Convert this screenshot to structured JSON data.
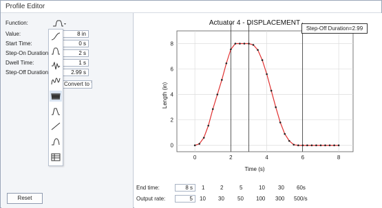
{
  "window": {
    "title": "Profile Editor"
  },
  "left": {
    "function_label": "Function:",
    "fields": [
      {
        "label": "Value:",
        "value": "8 in"
      },
      {
        "label": "Start Time:",
        "value": "0 s"
      },
      {
        "label": "Step-On Duration:",
        "value": "2 s"
      },
      {
        "label": "Dwell Time:",
        "value": "1 s"
      },
      {
        "label": "Step-Off Duration:",
        "value": "2.99 s"
      }
    ],
    "convert_label": "Convert to Table",
    "reset_label": "Reset",
    "menu_icons": [
      "s-curve-icon",
      "pulse-icon",
      "sine-burst-icon",
      "zigzag-icon",
      "wave-ramp-icon",
      "ramp-icon",
      "trapezoid-icon",
      "table-icon"
    ]
  },
  "chart_data": {
    "type": "line",
    "title": "Actuator 4 - DISPLACEMENT",
    "xlabel": "Time (s)",
    "ylabel": "Length (in)",
    "xlim": [
      -1,
      8.8
    ],
    "ylim": [
      -0.5,
      9
    ],
    "xticks": [
      0,
      2,
      4,
      6,
      8
    ],
    "yticks": [
      0,
      2,
      4,
      6,
      8
    ],
    "vlines": [
      2,
      3,
      5.99
    ],
    "series": [
      {
        "color": "#e03030",
        "x": [
          0,
          0.25,
          0.5,
          0.75,
          1.0,
          1.25,
          1.5,
          1.75,
          2.0,
          2.25,
          2.5,
          2.75,
          3.0,
          3.25,
          3.5,
          3.75,
          4.0,
          4.25,
          4.5,
          4.75,
          5.0,
          5.25,
          5.5,
          5.75,
          6.0,
          6.25,
          6.5,
          6.75,
          7.0,
          7.25,
          7.5,
          7.75,
          8.0
        ],
        "y": [
          0,
          0.12,
          0.6,
          1.55,
          2.85,
          4.0,
          5.15,
          6.45,
          7.55,
          8,
          8,
          8,
          8,
          7.9,
          7.5,
          6.7,
          5.6,
          4.3,
          3.0,
          1.8,
          0.9,
          0.35,
          0.05,
          0,
          0,
          0,
          0,
          0,
          0,
          0,
          0,
          0,
          0
        ]
      }
    ]
  },
  "tooltip": "Step-Off Duration=2.99",
  "bottom": {
    "end_time_label": "End time:",
    "end_time_value": "8 s",
    "end_time_options": [
      "1",
      "2",
      "5",
      "10",
      "30",
      "60s"
    ],
    "output_rate_label": "Output rate:",
    "output_rate_value": "5",
    "output_rate_options": [
      "10",
      "30",
      "50",
      "100",
      "300",
      "500/s"
    ]
  }
}
